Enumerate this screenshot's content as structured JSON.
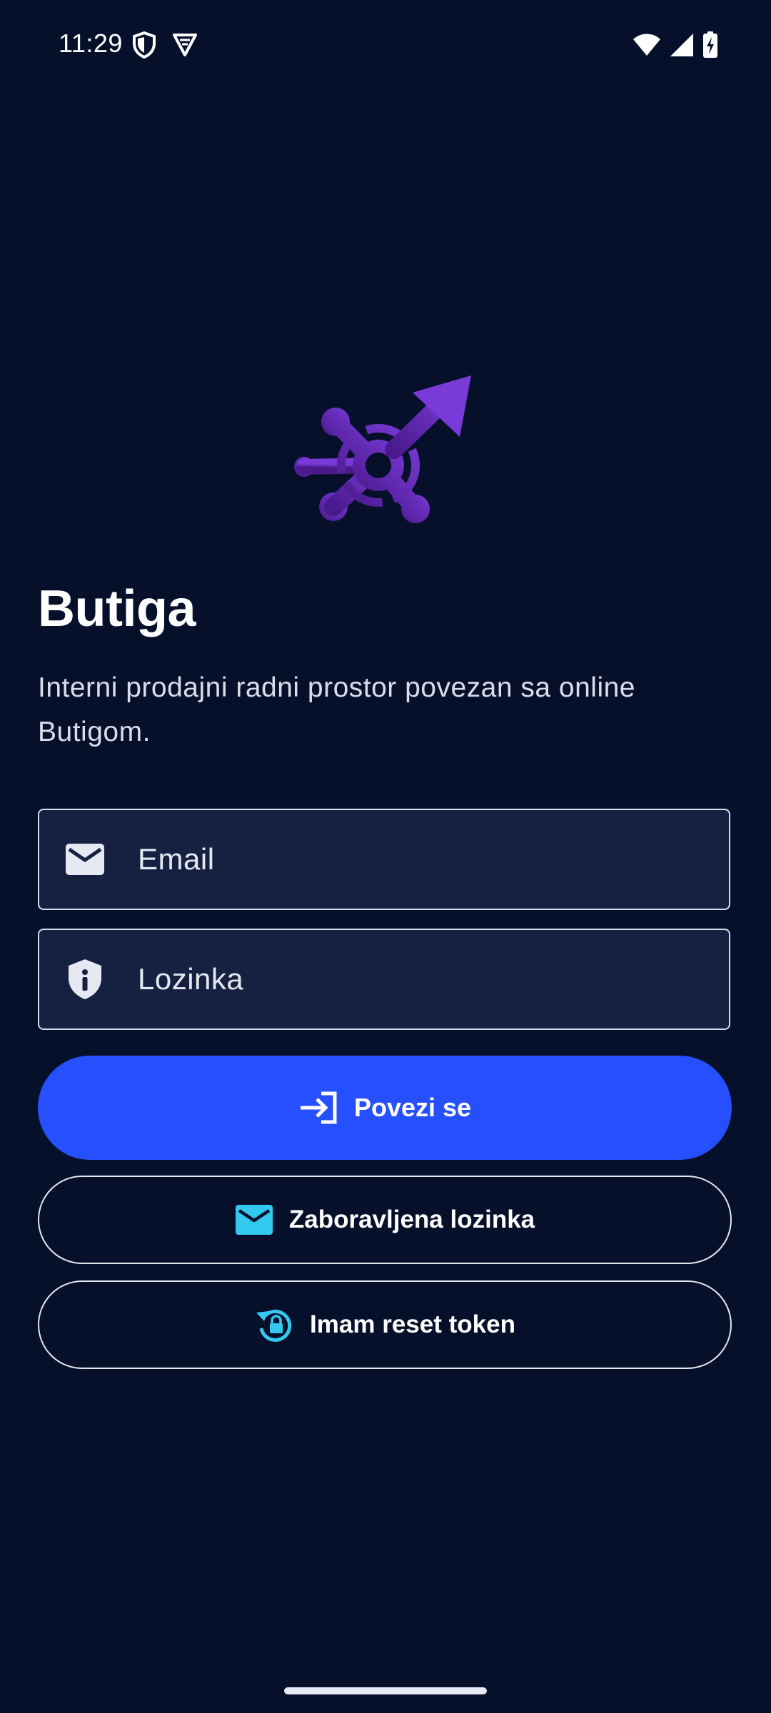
{
  "status_bar": {
    "time": "11:29",
    "left_icons": [
      "shield-icon",
      "vpn-icon"
    ],
    "right_icons": [
      "wifi-icon",
      "signal-icon",
      "battery-charging-icon"
    ]
  },
  "app": {
    "title": "Butiga",
    "subtitle": "Interni prodajni radni prostor povezan sa online Butigom.",
    "logo_icon": "butiga-logo-icon"
  },
  "form": {
    "email_placeholder": "Email",
    "email_value": "",
    "password_placeholder": "Lozinka",
    "password_value": ""
  },
  "buttons": {
    "login_label": "Povezi se",
    "forgot_label": "Zaboravljena lozinka",
    "reset_label": "Imam reset token"
  },
  "colors": {
    "background": "#07102a",
    "field_background": "#162040",
    "primary": "#2650ff",
    "accent_icon": "#33c8f0",
    "logo_gradient_start": "#5a1fa0",
    "logo_gradient_end": "#7b3ad6"
  }
}
